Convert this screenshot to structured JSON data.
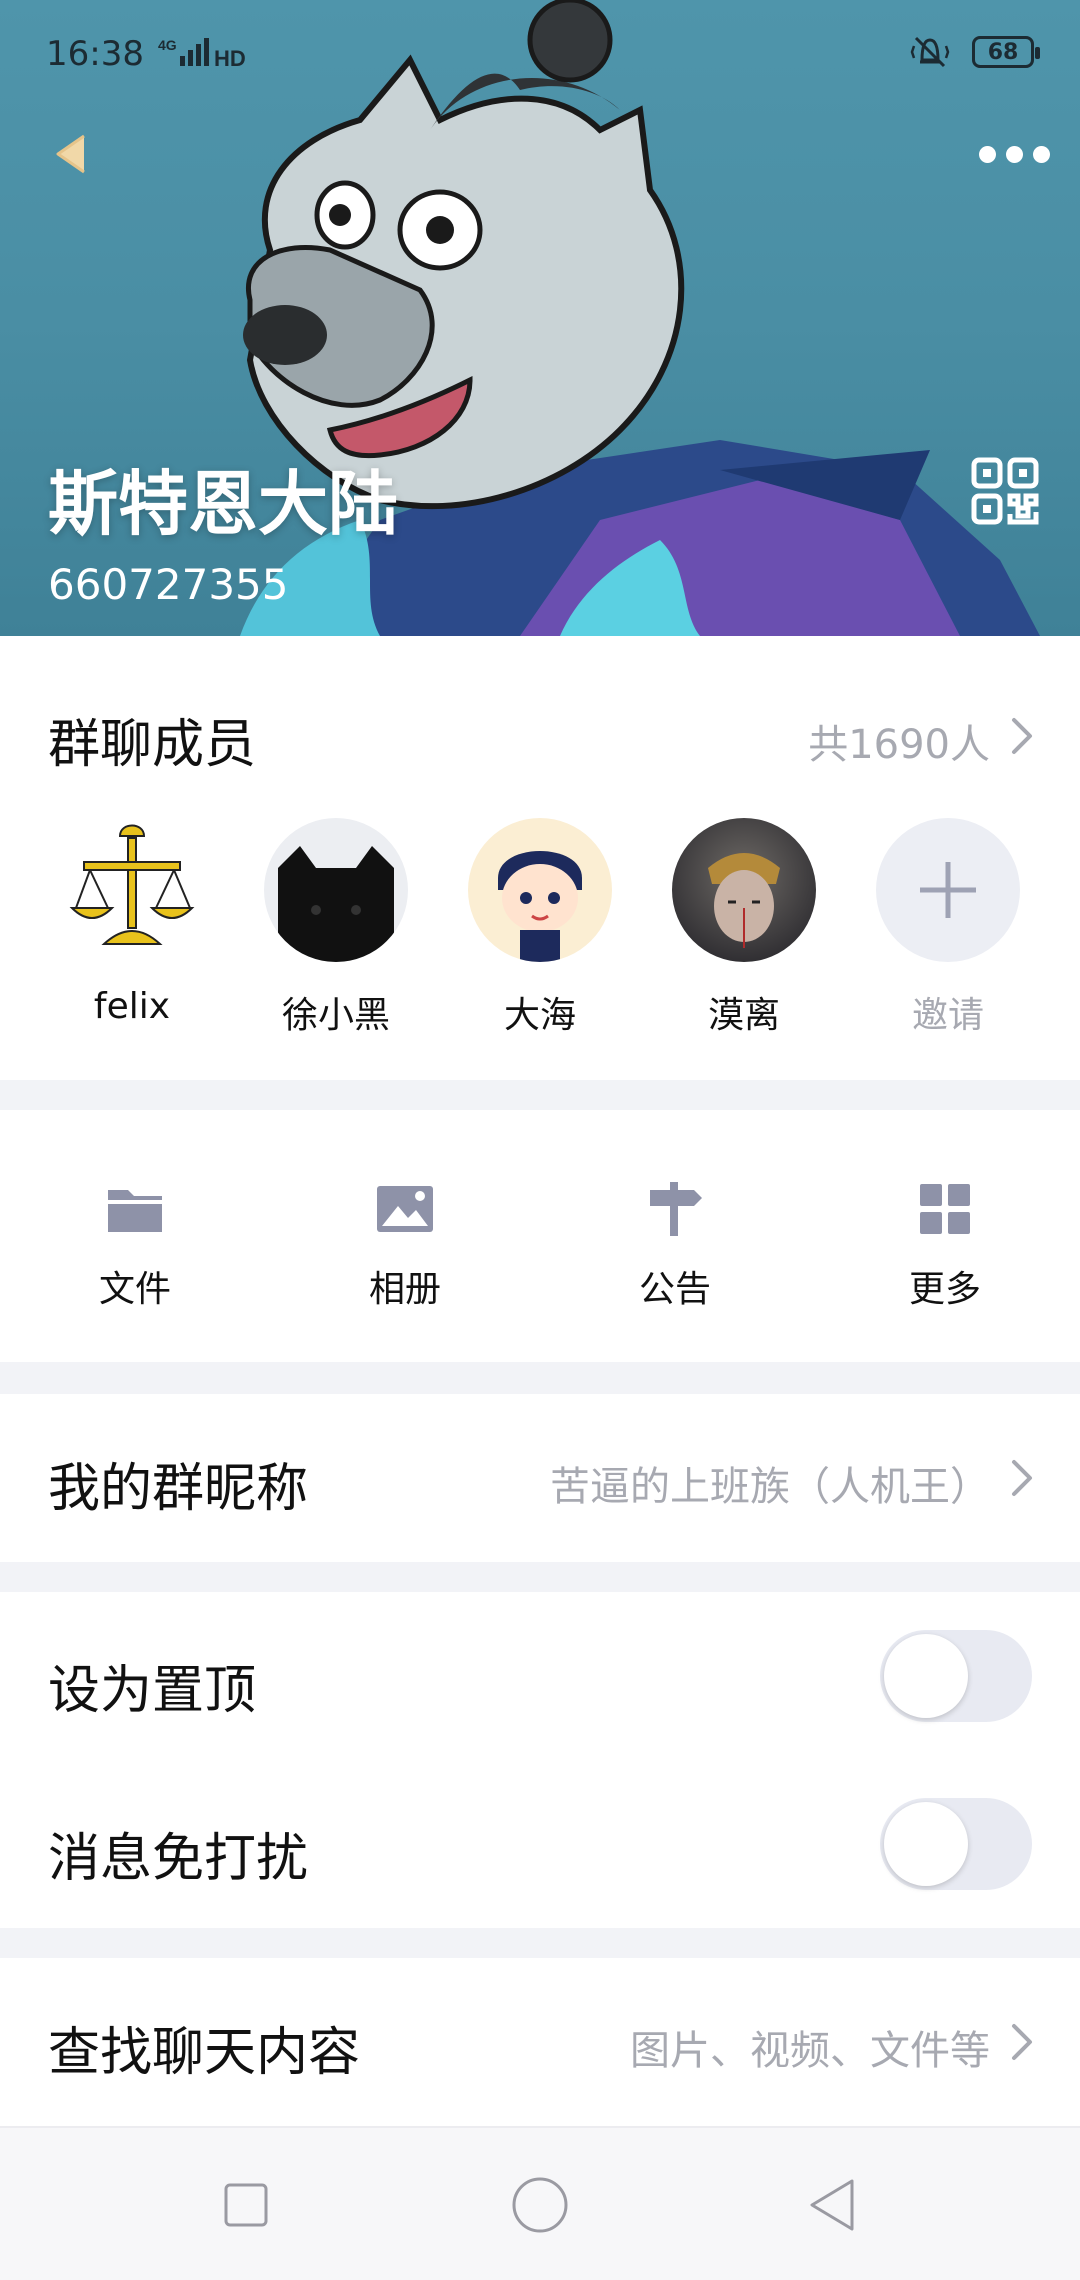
{
  "status_bar": {
    "time": "16:38",
    "network": "4G",
    "hd_label": "HD",
    "battery_level": "68",
    "mute_icon": "vibrate-bell-icon"
  },
  "header": {
    "group_name": "斯特恩大陆",
    "group_id": "660727355",
    "back_icon": "back-arrow-icon",
    "more_icon": "more-dots-icon",
    "qr_icon": "qr-code-icon",
    "accent_color": "#4a8ea4"
  },
  "members": {
    "title": "群聊成员",
    "count_text": "共1690人",
    "list": [
      {
        "name": "felix"
      },
      {
        "name": "徐小黑"
      },
      {
        "name": "大海"
      },
      {
        "name": "漠离"
      }
    ],
    "invite_label": "邀请"
  },
  "tools": [
    {
      "label": "文件",
      "icon": "folder-icon"
    },
    {
      "label": "相册",
      "icon": "photo-icon"
    },
    {
      "label": "公告",
      "icon": "signpost-icon"
    },
    {
      "label": "更多",
      "icon": "grid-icon"
    }
  ],
  "nickname": {
    "title": "我的群昵称",
    "value": "苦逼的上班族（人机王）"
  },
  "toggles": {
    "pin_label": "设为置顶",
    "pin_on": false,
    "mute_label": "消息免打扰",
    "mute_on": false
  },
  "search": {
    "title": "查找聊天内容",
    "hint": "图片、视频、文件等"
  },
  "colors": {
    "secondary_text": "#a7a9b1",
    "icon_color": "#8e92a8",
    "page_bg": "#f2f3f7"
  }
}
